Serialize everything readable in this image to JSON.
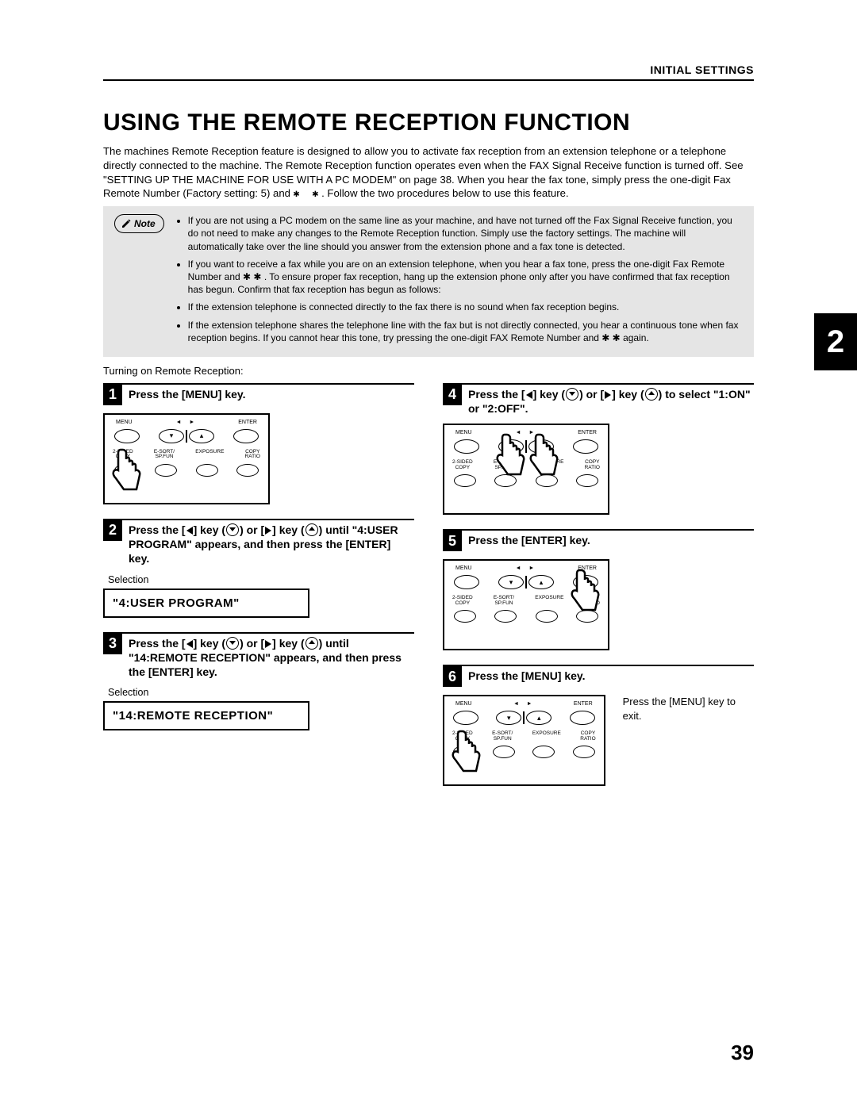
{
  "header": {
    "section": "INITIAL SETTINGS"
  },
  "title": "USING THE REMOTE RECEPTION FUNCTION",
  "intro": "The machines Remote Reception feature is designed to allow you to activate fax reception from an extension telephone or a telephone directly connected to the machine. The Remote Reception function operates even when the FAX Signal Receive function is turned off. See \"SETTING UP THE MACHINE FOR USE WITH A PC MODEM\" on page 38. When you hear the fax tone, simply press the one-digit Fax Remote Number (Factory setting: 5) and ",
  "intro_tail": ". Follow the two procedures below to use this feature.",
  "note_label": "Note",
  "note_items": [
    "If you are not using a PC modem on the same line as your machine, and have not turned off the Fax Signal Receive function, you do not need to make any changes to the Remote Reception function. Simply use the factory settings. The machine will automatically take over the line should you answer from the extension phone and a fax tone is detected.",
    "If you want to receive a fax while you are on an extension telephone, when you hear a fax tone, press the one-digit Fax Remote Number and  ✱  ✱ . To ensure proper fax reception,  hang up the extension phone only after you have confirmed that fax reception has begun. Confirm that fax reception has begun as follows:",
    "If the extension telephone is connected directly to the fax there is no sound when fax reception begins.",
    "If the extension telephone shares the telephone line with the fax but is not directly  connected, you hear a continuous tone when fax reception begins. If you cannot hear this tone, try pressing the one-digit FAX Remote Number and  ✱   ✱  again."
  ],
  "turning_on": "Turning on Remote Reception:",
  "panel_labels": {
    "menu": "MENU",
    "left_arrow": "◄",
    "right_arrow": "►",
    "enter": "ENTER",
    "row2a": "2-SIDED",
    "row2a2": "COPY",
    "row2b": "E-SORT/",
    "row2b2": "SP.FUN",
    "row2c": "EXPOSURE",
    "row2d": "COPY",
    "row2d2": "RATIO"
  },
  "steps": {
    "s1": {
      "num": "1",
      "title": "Press the [MENU] key."
    },
    "s2": {
      "num": "2",
      "title_a": "Press the [",
      "title_b": "] key (",
      "title_c": ") or [",
      "title_d": "] key (",
      "title_e": ") until \"4:USER PROGRAM\" appears, and then press the [ENTER] key.",
      "selection": "Selection",
      "lcd": "\"4:USER PROGRAM\""
    },
    "s3": {
      "num": "3",
      "title_a": "Press the [",
      "title_b": "] key (",
      "title_c": ") or [",
      "title_d": "] key (",
      "title_e": ") until \"14:REMOTE RECEPTION\" appears, and then press the [ENTER] key.",
      "selection": "Selection",
      "lcd": "\"14:REMOTE RECEPTION\""
    },
    "s4": {
      "num": "4",
      "title_a": "Press the [",
      "title_b": "] key (",
      "title_c": ") or [",
      "title_d": "] key (",
      "title_e": ") to select \"1:ON\" or \"2:OFF\"."
    },
    "s5": {
      "num": "5",
      "title": "Press the [ENTER] key."
    },
    "s6": {
      "num": "6",
      "title": "Press the [MENU] key.",
      "side": "Press the [MENU] key to exit."
    }
  },
  "chapter": "2",
  "page_number": "39"
}
